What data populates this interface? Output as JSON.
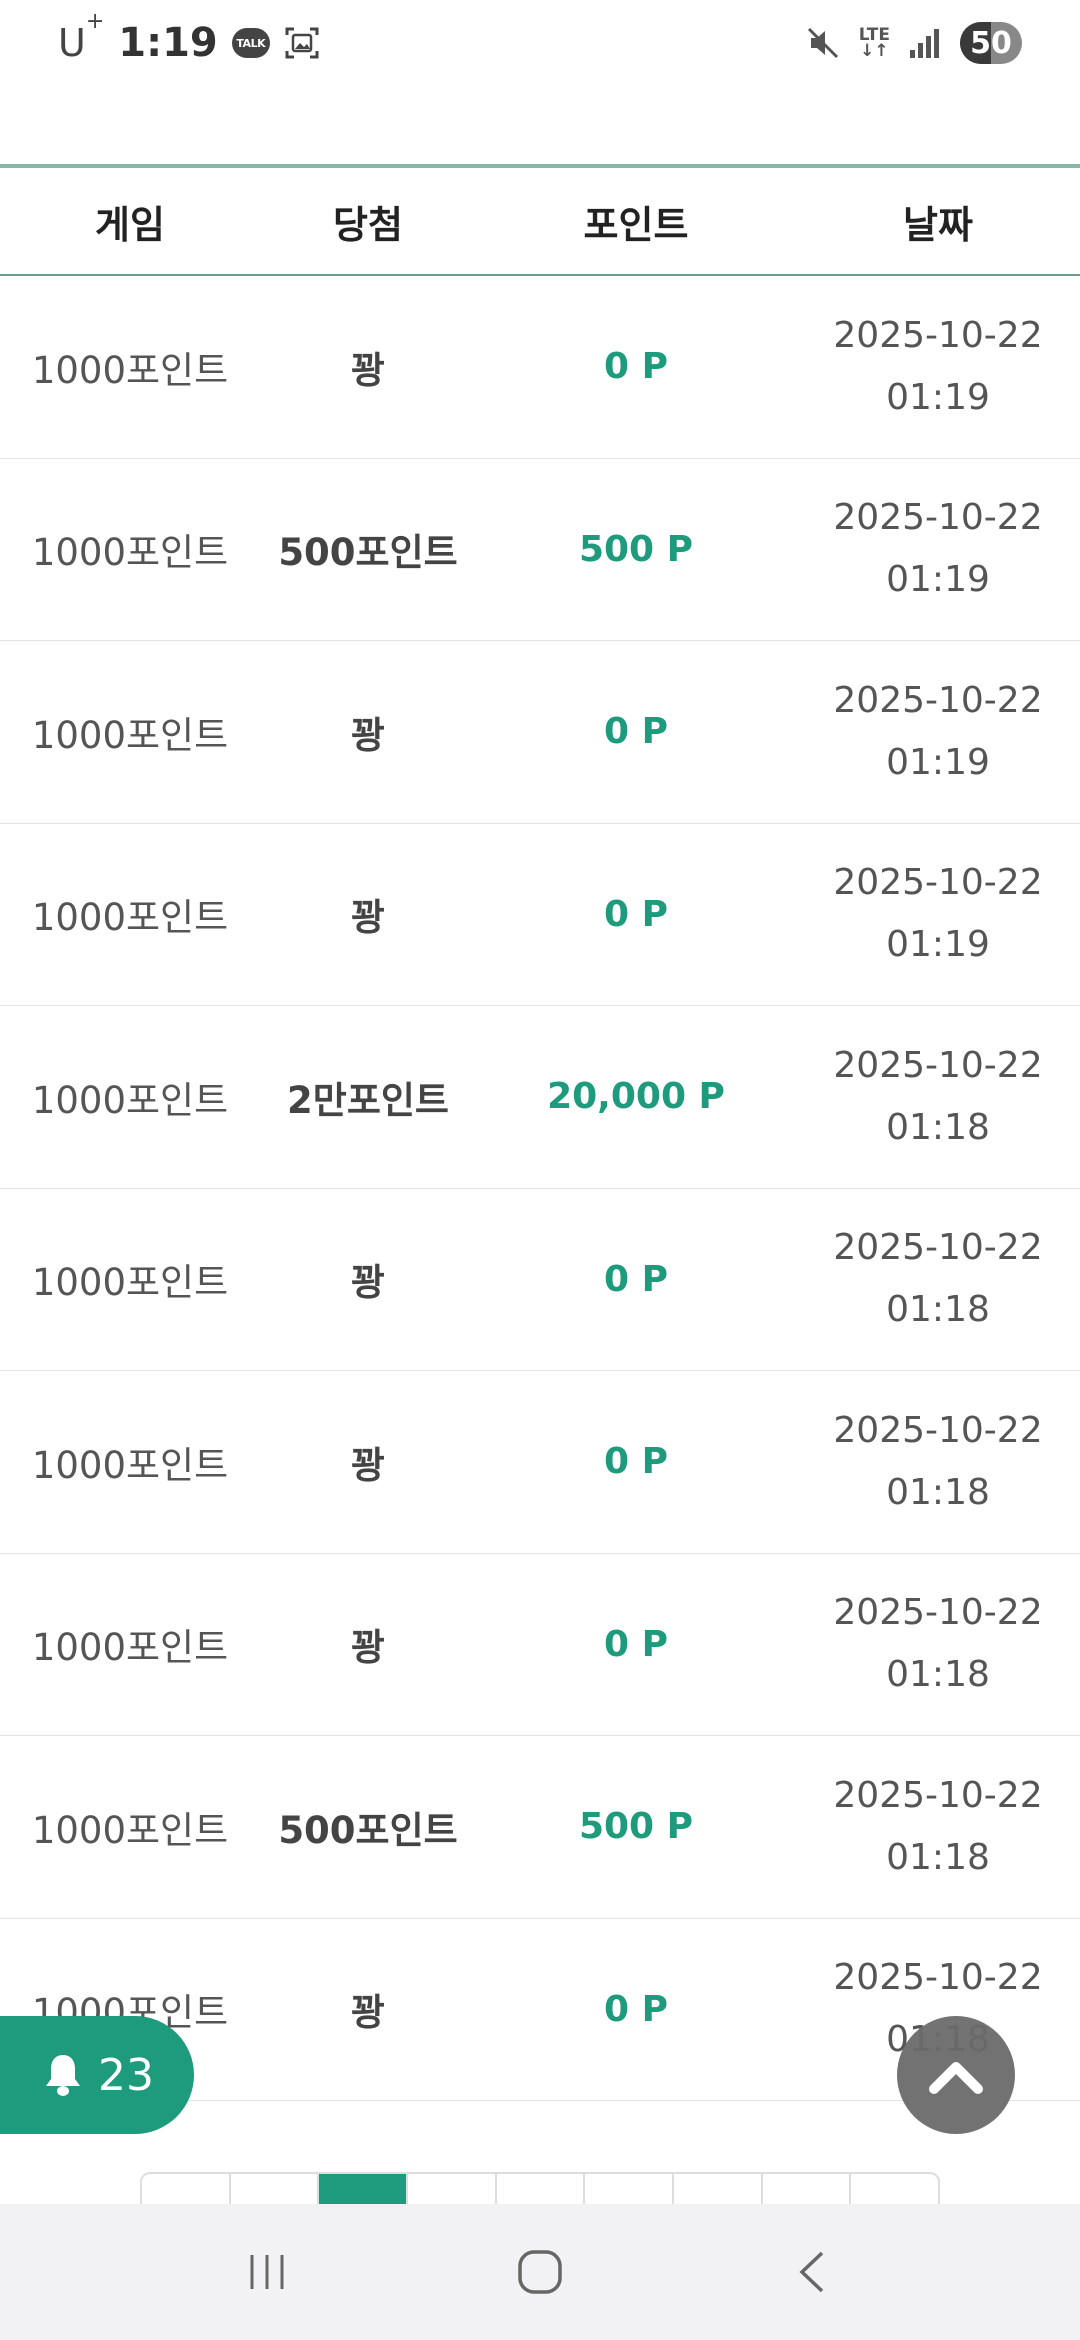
{
  "status_bar": {
    "carrier": "U",
    "carrier_sup": "+",
    "time": "1:19",
    "talk_label": "TALK",
    "network": "LTE",
    "battery": "50",
    "battery_level": 0.5
  },
  "table": {
    "headers": [
      "게임",
      "당첨",
      "포인트",
      "날짜"
    ],
    "rows": [
      {
        "game": "1000포인트",
        "win": "꽝",
        "points": "0 P",
        "date": "2025-10-22",
        "time": "01:19"
      },
      {
        "game": "1000포인트",
        "win": "500포인트",
        "points": "500 P",
        "date": "2025-10-22",
        "time": "01:19"
      },
      {
        "game": "1000포인트",
        "win": "꽝",
        "points": "0 P",
        "date": "2025-10-22",
        "time": "01:19"
      },
      {
        "game": "1000포인트",
        "win": "꽝",
        "points": "0 P",
        "date": "2025-10-22",
        "time": "01:19"
      },
      {
        "game": "1000포인트",
        "win": "2만포인트",
        "points": "20,000 P",
        "date": "2025-10-22",
        "time": "01:18"
      },
      {
        "game": "1000포인트",
        "win": "꽝",
        "points": "0 P",
        "date": "2025-10-22",
        "time": "01:18"
      },
      {
        "game": "1000포인트",
        "win": "꽝",
        "points": "0 P",
        "date": "2025-10-22",
        "time": "01:18"
      },
      {
        "game": "1000포인트",
        "win": "꽝",
        "points": "0 P",
        "date": "2025-10-22",
        "time": "01:18"
      },
      {
        "game": "1000포인트",
        "win": "500포인트",
        "points": "500 P",
        "date": "2025-10-22",
        "time": "01:18"
      },
      {
        "game": "1000포인트",
        "win": "꽝",
        "points": "0 P",
        "date": "2025-10-22",
        "time": "01:18"
      }
    ]
  },
  "notification": {
    "count": "23",
    "icon": "bell-icon"
  },
  "scroll_top": {
    "icon": "chevron-up-icon"
  },
  "colors": {
    "accent": "#1e9a7c",
    "header_line": "#8ab6a5"
  },
  "nav": {
    "icons": [
      "recent-apps-icon",
      "home-icon",
      "back-icon"
    ]
  }
}
